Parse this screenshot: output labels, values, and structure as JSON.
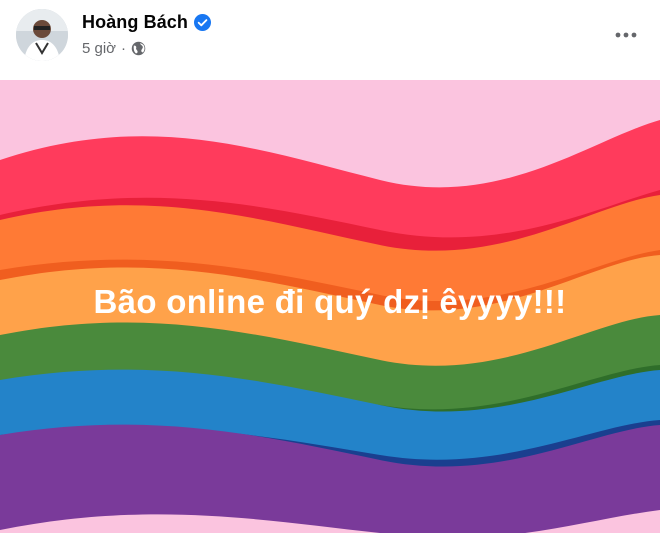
{
  "post": {
    "author_name": "Hoàng Bách",
    "time_ago": "5 giờ",
    "separator": "·",
    "visibility_icon": "globe-icon",
    "verified_icon": "verified-badge-icon",
    "more_icon": "more-options-icon",
    "text": "Bão online đi quý dzị êyyyy!!!"
  },
  "colors": {
    "verified": "#1877f2",
    "name": "#050505",
    "meta": "#65676b",
    "background_pink": "#fbc4df",
    "red": "#ff3b5c",
    "orange": "#ff7a35",
    "yellow_orange": "#ffa24a",
    "green": "#4a8a3c",
    "blue": "#2383c9",
    "purple": "#7a3a9a",
    "text": "#ffffff"
  }
}
